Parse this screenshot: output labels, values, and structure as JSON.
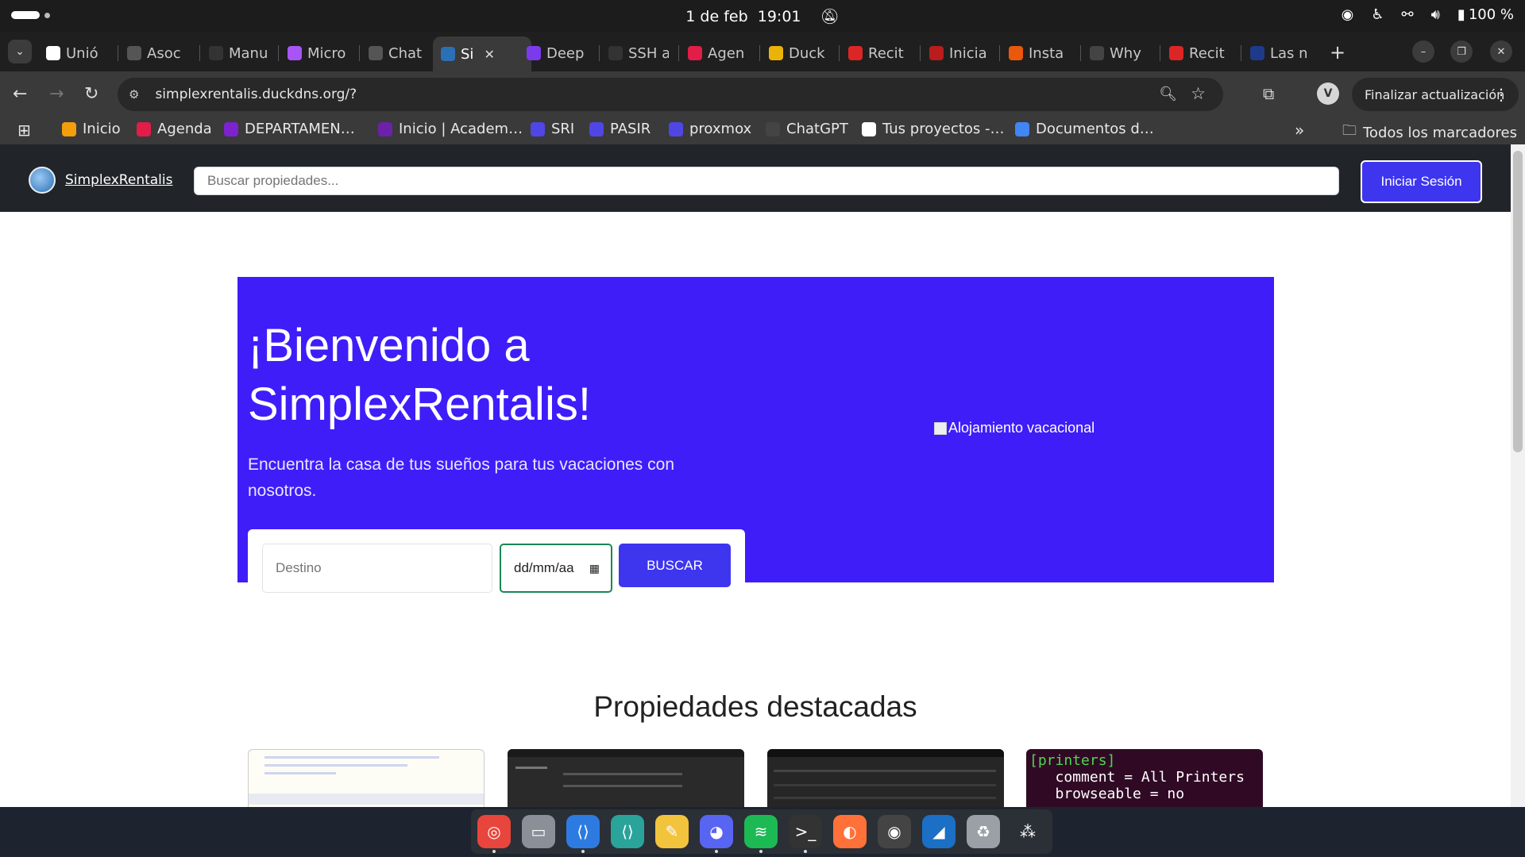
{
  "system": {
    "date": "1 de feb",
    "time": "19:01",
    "battery": "100 %"
  },
  "tabs": [
    {
      "label": "Unió",
      "icon": "notion-icon",
      "color": "#ffffff"
    },
    {
      "label": "Asoc",
      "icon": "chatgpt-icon",
      "color": "#555555"
    },
    {
      "label": "Manu",
      "icon": "github-icon",
      "color": "#333333"
    },
    {
      "label": "Micro",
      "icon": "microsoft-icon",
      "color": "#a855f7"
    },
    {
      "label": "Chat",
      "icon": "chatgpt-icon",
      "color": "#555555"
    },
    {
      "label": "Si",
      "icon": "simplex-icon",
      "color": "#2b6fb4",
      "active": true,
      "close": "✕"
    },
    {
      "label": "Deep",
      "icon": "deepseek-icon",
      "color": "#7c3aed"
    },
    {
      "label": "SSH a",
      "icon": "github-icon",
      "color": "#333333"
    },
    {
      "label": "Agen",
      "icon": "pin-icon",
      "color": "#e11d48"
    },
    {
      "label": "Duck",
      "icon": "duck-icon",
      "color": "#eab308"
    },
    {
      "label": "Recit",
      "icon": "gmail-icon",
      "color": "#dc2626"
    },
    {
      "label": "Inicia",
      "icon": "red-circle-icon",
      "color": "#b91c1c"
    },
    {
      "label": "Insta",
      "icon": "orange-icon",
      "color": "#ea580c"
    },
    {
      "label": "Why",
      "icon": "gitcup-icon",
      "color": "#444444"
    },
    {
      "label": "Recit",
      "icon": "gmail-icon",
      "color": "#dc2626"
    },
    {
      "label": "Las n",
      "icon": "booking-icon",
      "color": "#1e3a8a"
    }
  ],
  "toolbar": {
    "url": "simplexrentalis.duckdns.org/?",
    "update_label": "Finalizar actualización"
  },
  "bookmarks": [
    {
      "label": "Inicio",
      "icon": "moodle-icon",
      "color": "#f59e0b"
    },
    {
      "label": "Agenda",
      "icon": "pin-icon",
      "color": "#e11d48"
    },
    {
      "label": "DEPARTAMEN…",
      "icon": "dept-icon",
      "color": "#7e22ce"
    },
    {
      "label": "Inicio | Academ…",
      "icon": "academ-icon",
      "color": "#6b21a8"
    },
    {
      "label": "SRI",
      "icon": "forms-icon",
      "color": "#4f46e5"
    },
    {
      "label": "PASIR",
      "icon": "forms-icon",
      "color": "#4f46e5"
    },
    {
      "label": "proxmox",
      "icon": "forms-icon",
      "color": "#4f46e5"
    },
    {
      "label": "ChatGPT",
      "icon": "chatgpt-icon",
      "color": "#444444"
    },
    {
      "label": "Tus proyectos -…",
      "icon": "projects-icon",
      "color": "#ffffff"
    },
    {
      "label": "Documentos d…",
      "icon": "docs-icon",
      "color": "#4285f4"
    }
  ],
  "all_bookmarks_label": "Todos los marcadores",
  "site": {
    "brand": "SimplexRentalis",
    "search_placeholder": "Buscar propiedades...",
    "login_label": "Iniciar Sesión",
    "hero_title": "¡Bienvenido a SimplexRentalis!",
    "hero_subtitle": "Encuentra la casa de tus sueños para tus vacaciones con nosotros.",
    "hero_image_alt": "Alojamiento vacacional",
    "destination_placeholder": "Destino",
    "date_placeholder": "dd/mm/aa",
    "search_button": "BUSCAR",
    "featured_title": "Propiedades destacadas",
    "card4_lines": [
      "[printers]",
      "   comment = All Printers",
      "   browseable = no"
    ]
  },
  "dock": [
    {
      "name": "chrome-icon",
      "color": "#e8453c"
    },
    {
      "name": "files-icon",
      "color": "#8a8f98"
    },
    {
      "name": "vscode-icon",
      "color": "#2d7be0"
    },
    {
      "name": "vscode-alt-icon",
      "color": "#2aa39a"
    },
    {
      "name": "notes-icon",
      "color": "#f2c33c"
    },
    {
      "name": "discord-icon",
      "color": "#5865f2"
    },
    {
      "name": "spotify-icon",
      "color": "#1db954"
    },
    {
      "name": "terminal-icon",
      "color": "#333333"
    },
    {
      "name": "firefox-icon",
      "color": "#ff7139"
    },
    {
      "name": "obs-icon",
      "color": "#444444"
    },
    {
      "name": "wireshark-icon",
      "color": "#1b6fc4"
    },
    {
      "name": "trash-icon",
      "color": "#9aa0a6"
    },
    {
      "name": "apps-grid-icon",
      "color": "#2b2f36"
    }
  ]
}
